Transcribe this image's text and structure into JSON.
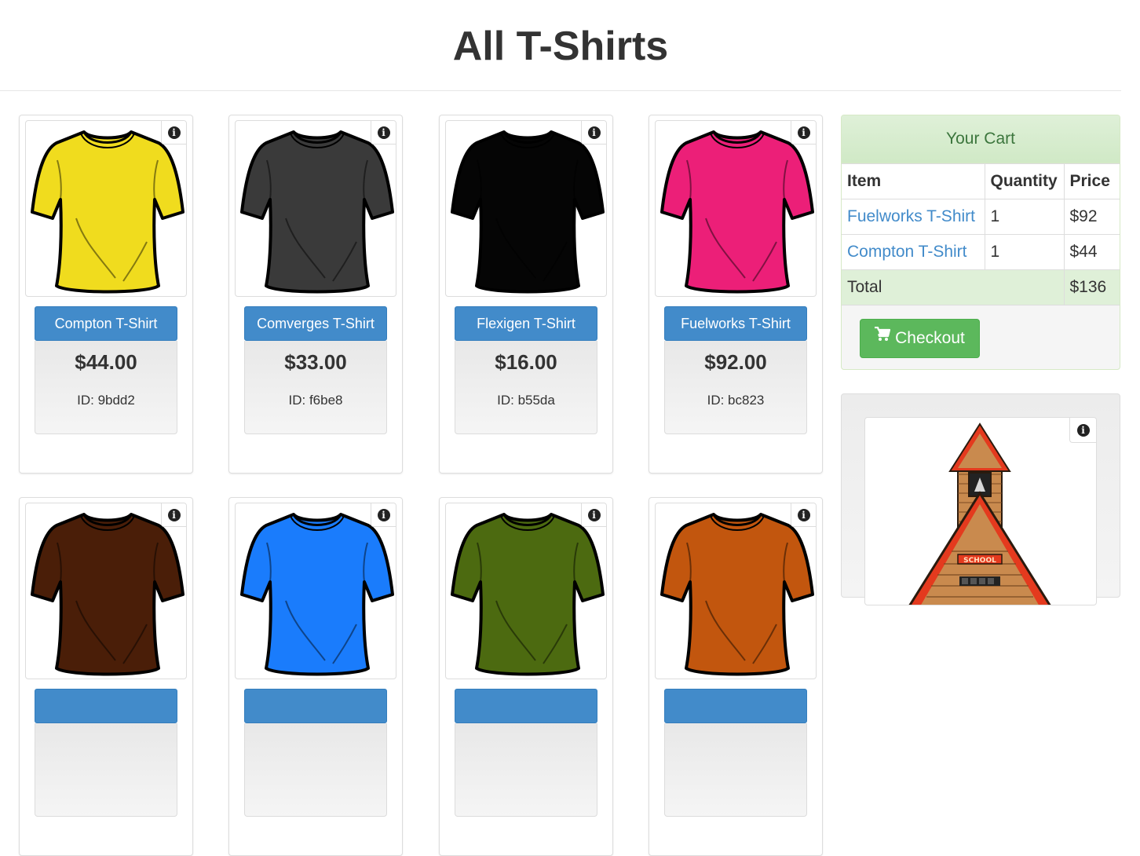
{
  "page": {
    "title": "All T-Shirts"
  },
  "products": [
    {
      "name": "Compton T-Shirt",
      "price": "$44.00",
      "id": "ID: 9bdd2",
      "color": "#f0dc1e"
    },
    {
      "name": "Comverges T-Shirt",
      "price": "$33.00",
      "id": "ID: f6be8",
      "color": "#3a3a3a"
    },
    {
      "name": "Flexigen T-Shirt",
      "price": "$16.00",
      "id": "ID: b55da",
      "color": "#050505"
    },
    {
      "name": "Fuelworks T-Shirt",
      "price": "$92.00",
      "id": "ID: bc823",
      "color": "#ec1f78"
    },
    {
      "name": "",
      "price": "",
      "id": "",
      "color": "#4a1e08"
    },
    {
      "name": "",
      "price": "",
      "id": "",
      "color": "#1a7cfc"
    },
    {
      "name": "",
      "price": "",
      "id": "",
      "color": "#4c6a10"
    },
    {
      "name": "",
      "price": "",
      "id": "",
      "color": "#c2560e"
    }
  ],
  "icons": {
    "info": "info-icon",
    "cart": "shopping-cart-icon",
    "school": "schoolhouse-illustration"
  },
  "cart": {
    "heading": "Your Cart",
    "columns": [
      "Item",
      "Quantity",
      "Price"
    ],
    "rows": [
      {
        "item": "Fuelworks T-Shirt",
        "quantity": "1",
        "price": "$92"
      },
      {
        "item": "Compton T-Shirt",
        "quantity": "1",
        "price": "$44"
      }
    ],
    "total_label": "Total",
    "total_value": "$136",
    "checkout_label": "Checkout"
  },
  "school": {
    "sign": "SCHOOL"
  },
  "colors": {
    "primary": "#428bca",
    "success": "#5cb85c",
    "cart_header_text": "#3c763d",
    "cart_header_bg": "#dff0d8"
  }
}
